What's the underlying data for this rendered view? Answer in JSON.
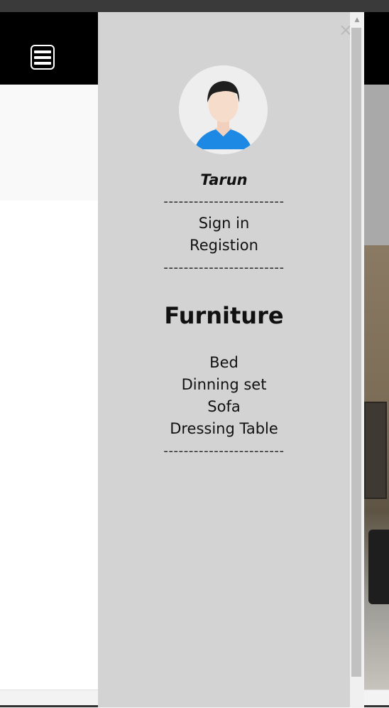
{
  "header": {
    "menu_icon": "hamburger-icon"
  },
  "drawer": {
    "close_label": "×",
    "close_icon": "close-icon",
    "avatar_icon": "user-avatar-icon",
    "username": "Tarun",
    "divider": "------------------------",
    "auth_links": [
      "Sign in",
      "Registion"
    ],
    "section_title": "Furniture",
    "categories": [
      "Bed",
      "Dinning set",
      "Sofa",
      "Dressing Table"
    ]
  },
  "scrollbar": {
    "up_arrow": "▲"
  },
  "colors": {
    "header_bg": "#000000",
    "drawer_bg": "#d3d3d3",
    "avatar_shirt": "#1e88e5"
  }
}
